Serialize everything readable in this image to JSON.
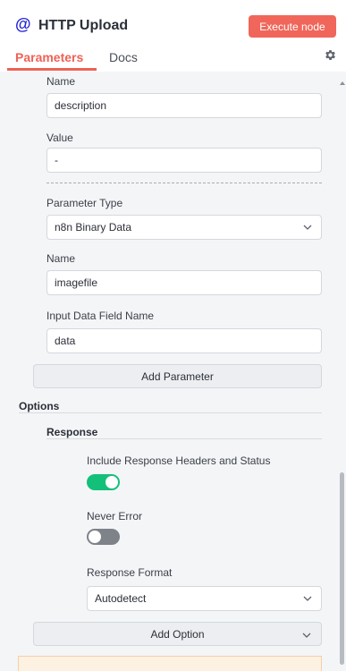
{
  "header": {
    "title": "HTTP Upload",
    "execute_label": "Execute node",
    "accent": "#ef6155"
  },
  "tabs": [
    {
      "label": "Parameters",
      "active": true
    },
    {
      "label": "Docs",
      "active": false
    }
  ],
  "params": {
    "name1_label": "Name",
    "name1_value": "description",
    "value_label": "Value",
    "value_value": "-",
    "type_label": "Parameter Type",
    "type_value": "n8n Binary Data",
    "name2_label": "Name",
    "name2_value": "imagefile",
    "field_label": "Input Data Field Name",
    "field_value": "data",
    "add_parameter": "Add Parameter"
  },
  "options": {
    "title": "Options",
    "response_title": "Response",
    "include_headers_label": "Include Response Headers and Status",
    "include_headers_on": true,
    "never_error_label": "Never Error",
    "never_error_on": false,
    "format_label": "Response Format",
    "format_value": "Autodetect",
    "add_option": "Add Option"
  },
  "icons": {
    "node": "at-sign-icon",
    "settings": "gear-icon",
    "dropdown": "chevron-down-icon"
  }
}
